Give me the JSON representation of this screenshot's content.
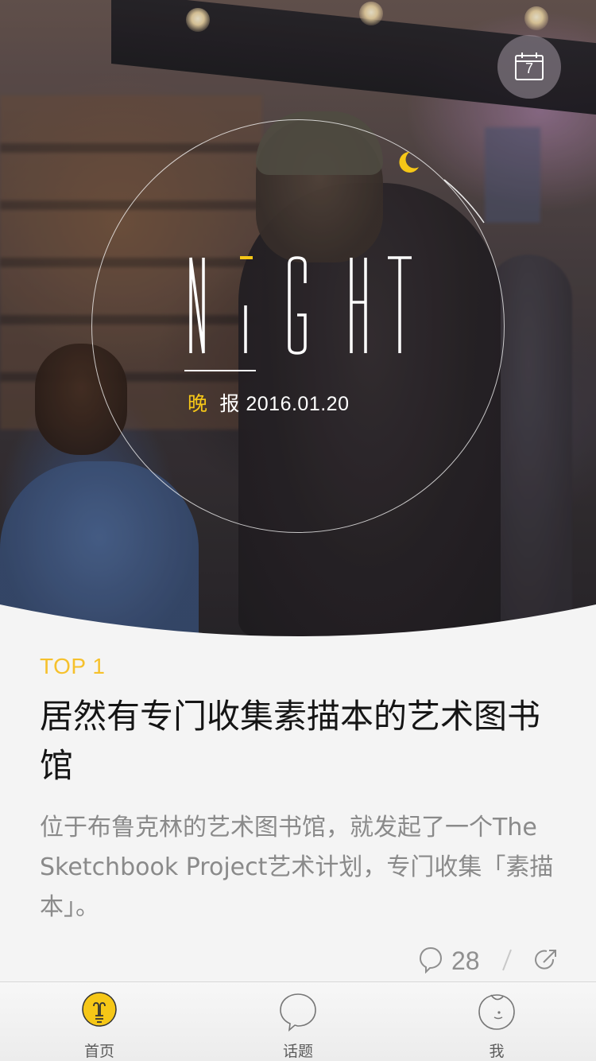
{
  "hero": {
    "logo_text": "NiGHT",
    "subtitle_highlight": "晚",
    "subtitle_rest": "报 2016.01.20",
    "calendar_day": "7",
    "accent_color": "#f6c717"
  },
  "article": {
    "rank": "TOP 1",
    "title": "居然有专门收集素描本的艺术图书馆",
    "summary": "位于布鲁克林的艺术图书馆，就发起了一个The Sketchbook Project艺术计划，专门收集「素描本」。",
    "comment_count": "28",
    "rank_color": "#f6c12c"
  },
  "tabbar": {
    "tabs": [
      {
        "label": "首页",
        "icon": "lightbulb-icon",
        "active": true
      },
      {
        "label": "话题",
        "icon": "speech-bubble-icon",
        "active": false
      },
      {
        "label": "我",
        "icon": "face-icon",
        "active": false
      }
    ]
  }
}
